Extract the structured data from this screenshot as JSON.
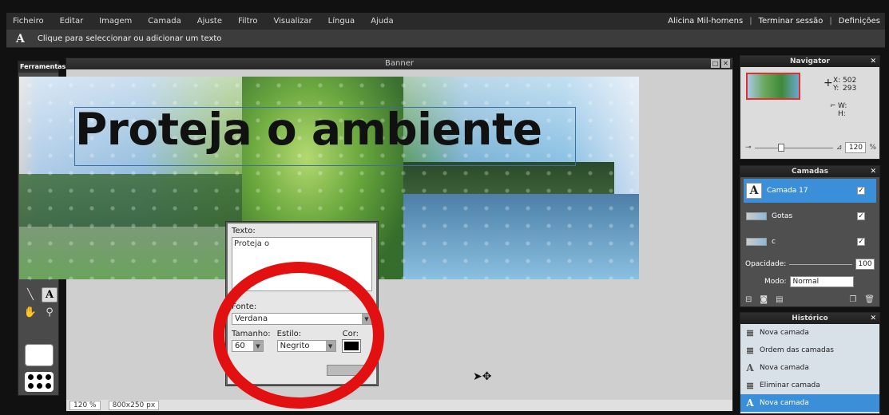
{
  "menubar": {
    "items": [
      "Ficheiro",
      "Editar",
      "Imagem",
      "Camada",
      "Ajuste",
      "Filtro",
      "Visualizar",
      "Língua",
      "Ajuda"
    ],
    "user": "Alicina Mil-homens",
    "sep": "|",
    "logout": "Terminar sessão",
    "settings": "Definições"
  },
  "options": {
    "tool_glyph": "A",
    "hint": "Clique para seleccionar ou adicionar um texto"
  },
  "toolbox": {
    "title": "Ferramentas",
    "active_tool_glyph": "A"
  },
  "document": {
    "title": "Banner",
    "zoom": "120 %",
    "size": "800x250 px",
    "headline": "Proteja o ambiente"
  },
  "text_dialog": {
    "text_label": "Texto:",
    "text_value": "Proteja o",
    "font_label": "Fonte:",
    "font_value": "Verdana",
    "size_label": "Tamanho:",
    "size_value": "60",
    "style_label": "Estilo:",
    "style_value": "Negrito",
    "color_label": "Cor:",
    "color_value": "#000000"
  },
  "navigator": {
    "title": "Navigator",
    "x_label": "X:",
    "x_value": "502",
    "y_label": "Y:",
    "y_value": "293",
    "w_label": "W:",
    "h_label": "H:",
    "zoom": "120",
    "zoom_unit": "%"
  },
  "layers": {
    "title": "Camadas",
    "items": [
      {
        "name": "Camada 17",
        "thumb": "A"
      },
      {
        "name": "Gotas",
        "thumb": ""
      },
      {
        "name": "c",
        "thumb": ""
      }
    ],
    "opacity_label": "Opacidade:",
    "opacity_value": "100",
    "mode_label": "Modo:",
    "mode_value": "Normal"
  },
  "history": {
    "title": "Histórico",
    "items": [
      "Nova camada",
      "Ordem das camadas",
      "Nova camada",
      "Eliminar camada",
      "Nova camada"
    ]
  },
  "colors": {
    "accent": "#3b8fd8",
    "annotation": "#e21010"
  }
}
